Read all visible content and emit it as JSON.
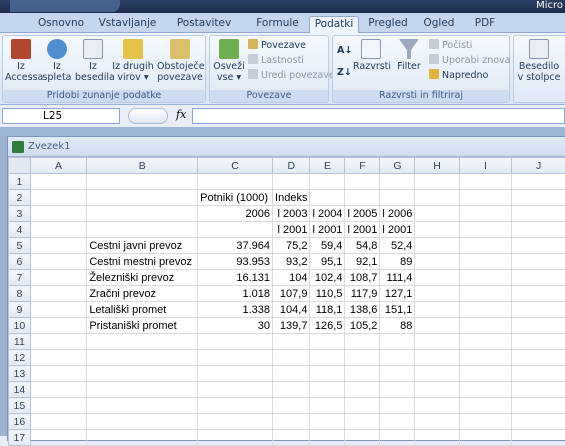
{
  "app": {
    "title": "Micro"
  },
  "tabs": [
    "Osnovno",
    "Vstavljanje",
    "Postavitev strani",
    "Formule",
    "Podatki",
    "Pregled",
    "Ogled",
    "PDF"
  ],
  "active_tab": "Podatki",
  "ribbon": {
    "group_external": {
      "name": "Pridobi zunanje podatke",
      "buttons": [
        {
          "l1": "Iz",
          "l2": "Accessa"
        },
        {
          "l1": "Iz",
          "l2": "spleta"
        },
        {
          "l1": "Iz",
          "l2": "besedila"
        },
        {
          "l1": "Iz drugih",
          "l2": "virov ▾"
        },
        {
          "l1": "Obstoječe",
          "l2": "povezave"
        }
      ]
    },
    "group_connections": {
      "name": "Povezave",
      "refresh": {
        "l1": "Osveži",
        "l2": "vse ▾"
      },
      "items": [
        "Povezave",
        "Lastnosti",
        "Uredi povezave"
      ]
    },
    "group_sort": {
      "name": "Razvrsti in filtriraj",
      "sort_label": "Razvrsti",
      "filter_label": "Filter",
      "items": [
        "Počisti",
        "Uporabi znova",
        "Napredno"
      ]
    },
    "group_tools": {
      "button": {
        "l1": "Besedilo",
        "l2": "v stolpce"
      }
    }
  },
  "formula_bar": {
    "name_box": "L25",
    "fx": "fx",
    "content": ""
  },
  "workbook": {
    "title": "Zvezek1"
  },
  "columns": [
    "A",
    "B",
    "C",
    "D",
    "E",
    "F",
    "G",
    "H",
    "I",
    "J"
  ],
  "rows": [
    {
      "n": "1",
      "cells": [
        "",
        "",
        "",
        "",
        "",
        "",
        "",
        "",
        "",
        ""
      ]
    },
    {
      "n": "2",
      "cells": [
        "",
        "",
        "Potniki (1000)",
        "Indeks",
        "",
        "",
        "",
        "",
        "",
        ""
      ]
    },
    {
      "n": "3",
      "cells": [
        "",
        "",
        "2006",
        "l 2003",
        "l 2004",
        "l 2005",
        "l 2006",
        "",
        "",
        ""
      ]
    },
    {
      "n": "4",
      "cells": [
        "",
        "",
        "",
        "l 2001",
        "l 2001",
        "l 2001",
        "l 2001",
        "",
        "",
        ""
      ]
    },
    {
      "n": "5",
      "cells": [
        "",
        "Cestni javni prevoz",
        "37.964",
        "75,2",
        "59,4",
        "54,8",
        "52,4",
        "",
        "",
        ""
      ]
    },
    {
      "n": "6",
      "cells": [
        "",
        "Cestni mestni prevoz",
        "93.953",
        "93,2",
        "95,1",
        "92,1",
        "89",
        "",
        "",
        ""
      ]
    },
    {
      "n": "7",
      "cells": [
        "",
        "Železniški prevoz",
        "16.131",
        "104",
        "102,4",
        "108,7",
        "111,4",
        "",
        "",
        ""
      ]
    },
    {
      "n": "8",
      "cells": [
        "",
        "Zračni prevoz",
        "1.018",
        "107,9",
        "110,5",
        "117,9",
        "127,1",
        "",
        "",
        ""
      ]
    },
    {
      "n": "9",
      "cells": [
        "",
        "Letališki promet",
        "1.338",
        "104,4",
        "118,1",
        "138,6",
        "151,1",
        "",
        "",
        ""
      ]
    },
    {
      "n": "10",
      "cells": [
        "",
        "Pristaniški promet",
        "30",
        "139,7",
        "126,5",
        "105,2",
        "88",
        "",
        "",
        ""
      ]
    },
    {
      "n": "11",
      "cells": [
        "",
        "",
        "",
        "",
        "",
        "",
        "",
        "",
        "",
        ""
      ]
    },
    {
      "n": "12",
      "cells": [
        "",
        "",
        "",
        "",
        "",
        "",
        "",
        "",
        "",
        ""
      ]
    },
    {
      "n": "13",
      "cells": [
        "",
        "",
        "",
        "",
        "",
        "",
        "",
        "",
        "",
        ""
      ]
    },
    {
      "n": "14",
      "cells": [
        "",
        "",
        "",
        "",
        "",
        "",
        "",
        "",
        "",
        ""
      ]
    },
    {
      "n": "15",
      "cells": [
        "",
        "",
        "",
        "",
        "",
        "",
        "",
        "",
        "",
        ""
      ]
    },
    {
      "n": "16",
      "cells": [
        "",
        "",
        "",
        "",
        "",
        "",
        "",
        "",
        "",
        ""
      ]
    },
    {
      "n": "17",
      "cells": [
        "",
        "",
        "",
        "",
        "",
        "",
        "",
        "",
        "",
        ""
      ]
    }
  ]
}
